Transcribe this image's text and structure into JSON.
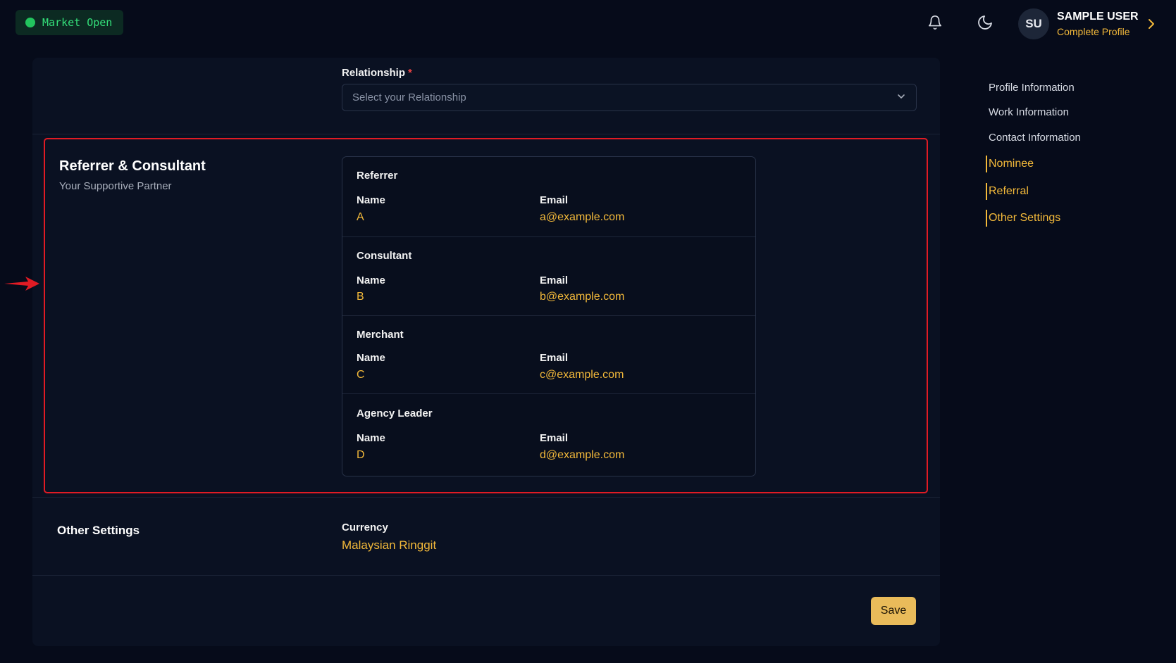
{
  "market_status": {
    "label": "Market Open"
  },
  "user": {
    "initials": "SU",
    "name": "SAMPLE USER",
    "subtitle": "Complete Profile"
  },
  "relationship": {
    "label": "Relationship",
    "required_mark": "*",
    "placeholder": "Select your Relationship"
  },
  "referrer_section": {
    "title": "Referrer & Consultant",
    "subtitle": "Your Supportive Partner",
    "blocks": [
      {
        "heading": "Referrer",
        "name_label": "Name",
        "email_label": "Email",
        "name": "A",
        "email": "a@example.com"
      },
      {
        "heading": "Consultant",
        "name_label": "Name",
        "email_label": "Email",
        "name": "B",
        "email": "b@example.com"
      },
      {
        "heading": "Merchant",
        "name_label": "Name",
        "email_label": "Email",
        "name": "C",
        "email": "c@example.com"
      },
      {
        "heading": "Agency Leader",
        "name_label": "Name",
        "email_label": "Email",
        "name": "D",
        "email": "d@example.com"
      }
    ]
  },
  "other_settings": {
    "title": "Other Settings",
    "currency_label": "Currency",
    "currency_value": "Malaysian Ringgit"
  },
  "actions": {
    "save_label": "Save"
  },
  "side_nav": {
    "items": [
      {
        "label": "Profile Information",
        "active": false
      },
      {
        "label": "Work Information",
        "active": false
      },
      {
        "label": "Contact Information",
        "active": false
      },
      {
        "label": "Nominee",
        "active": true
      },
      {
        "label": "Referral",
        "active": true
      },
      {
        "label": "Other Settings",
        "active": true
      }
    ]
  },
  "icons": [
    "bell-icon",
    "moon-icon",
    "chevron-right-icon",
    "chevron-down-icon",
    "arrow-right-icon"
  ],
  "colors": {
    "accent": "#f3b93a",
    "background": "#060b1a",
    "highlight": "#e01b24",
    "market_green": "#22c55e"
  }
}
